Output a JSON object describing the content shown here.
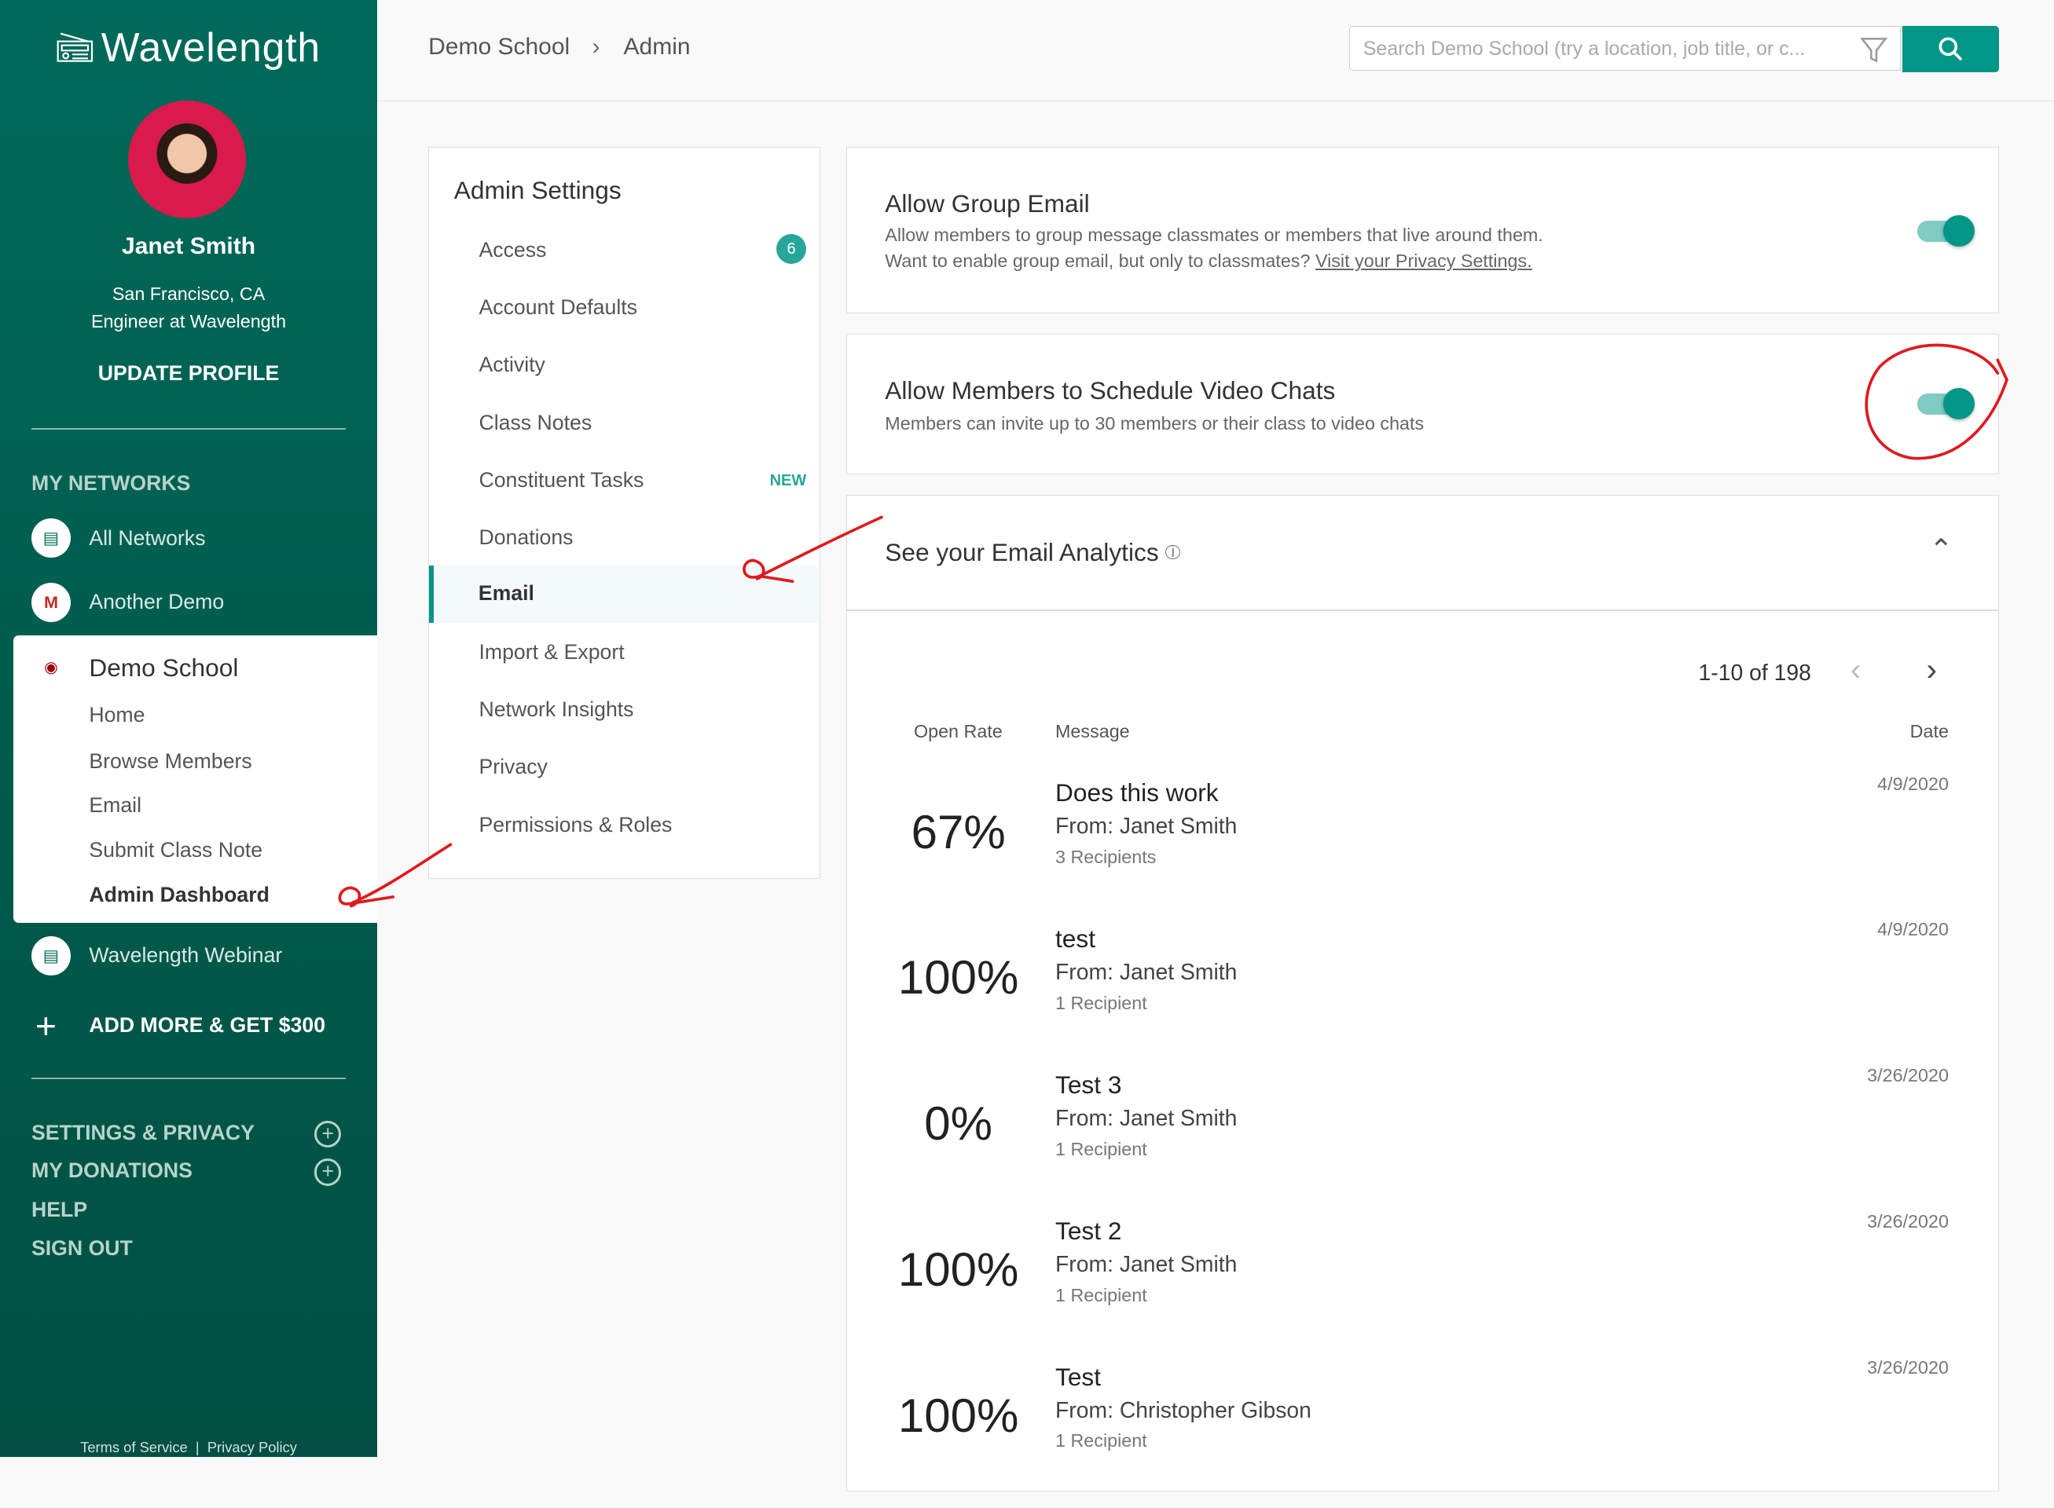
{
  "app": {
    "name": "Wavelength"
  },
  "profile": {
    "name": "Janet Smith",
    "location": "San Francisco, CA",
    "title": "Engineer at Wavelength",
    "update_label": "UPDATE PROFILE"
  },
  "sidebar": {
    "networks_heading": "MY NETWORKS",
    "networks": [
      {
        "label": "All Networks"
      },
      {
        "label": "Another Demo"
      },
      {
        "label": "Demo School"
      },
      {
        "label": "Wavelength Webinar"
      }
    ],
    "demo_school_links": [
      "Home",
      "Browse Members",
      "Email",
      "Submit Class Note",
      "Admin Dashboard"
    ],
    "add_more": "ADD MORE & GET $300",
    "bottom_links": [
      "SETTINGS & PRIVACY",
      "MY DONATIONS",
      "HELP",
      "SIGN OUT"
    ],
    "footer": {
      "terms": "Terms of Service",
      "separator": "|",
      "privacy": "Privacy Policy"
    }
  },
  "header": {
    "breadcrumb": [
      "Demo School",
      "Admin"
    ],
    "search_placeholder": "Search Demo School (try a location, job title, or c..."
  },
  "admin_settings": {
    "title": "Admin Settings",
    "items": [
      {
        "label": "Access",
        "badge": "6"
      },
      {
        "label": "Account Defaults"
      },
      {
        "label": "Activity"
      },
      {
        "label": "Class Notes"
      },
      {
        "label": "Constituent Tasks",
        "tag": "NEW"
      },
      {
        "label": "Donations"
      },
      {
        "label": "Email",
        "active": true
      },
      {
        "label": "Import & Export"
      },
      {
        "label": "Network Insights"
      },
      {
        "label": "Privacy"
      },
      {
        "label": "Permissions & Roles"
      }
    ]
  },
  "group_email": {
    "title": "Allow Group Email",
    "desc": "Allow members to group message classmates or members that live around them.",
    "desc2": "Want to enable group email, but only to classmates?",
    "link": "Visit your Privacy Settings.",
    "enabled": true
  },
  "video_chats": {
    "title": "Allow Members to Schedule Video Chats",
    "desc": "Members can invite up to 30 members or their class to video chats",
    "enabled": true
  },
  "analytics": {
    "title": "See your Email Analytics",
    "pagination": "1-10 of 198",
    "columns": {
      "rate": "Open Rate",
      "message": "Message",
      "date": "Date"
    },
    "rows": [
      {
        "rate": "67%",
        "title": "Does this work",
        "from": "From: Janet Smith",
        "recipients": "3 Recipients",
        "date": "4/9/2020"
      },
      {
        "rate": "100%",
        "title": "test",
        "from": "From: Janet Smith",
        "recipients": "1 Recipient",
        "date": "4/9/2020"
      },
      {
        "rate": "0%",
        "title": "Test 3",
        "from": "From: Janet Smith",
        "recipients": "1 Recipient",
        "date": "3/26/2020"
      },
      {
        "rate": "100%",
        "title": "Test 2",
        "from": "From: Janet Smith",
        "recipients": "1 Recipient",
        "date": "3/26/2020"
      },
      {
        "rate": "100%",
        "title": "Test",
        "from": "From: Christopher Gibson",
        "recipients": "1 Recipient",
        "date": "3/26/2020"
      }
    ]
  },
  "colors": {
    "brand": "#006a5a",
    "accent": "#009688",
    "annotation": "#e0191e"
  }
}
